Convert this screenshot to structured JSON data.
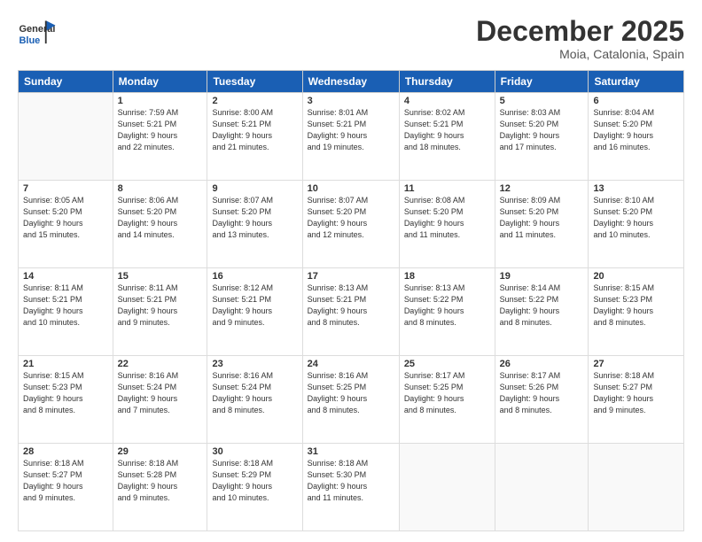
{
  "header": {
    "logo_line1": "General",
    "logo_line2": "Blue",
    "month": "December 2025",
    "location": "Moia, Catalonia, Spain"
  },
  "weekdays": [
    "Sunday",
    "Monday",
    "Tuesday",
    "Wednesday",
    "Thursday",
    "Friday",
    "Saturday"
  ],
  "weeks": [
    [
      {
        "day": "",
        "info": ""
      },
      {
        "day": "1",
        "info": "Sunrise: 7:59 AM\nSunset: 5:21 PM\nDaylight: 9 hours\nand 22 minutes."
      },
      {
        "day": "2",
        "info": "Sunrise: 8:00 AM\nSunset: 5:21 PM\nDaylight: 9 hours\nand 21 minutes."
      },
      {
        "day": "3",
        "info": "Sunrise: 8:01 AM\nSunset: 5:21 PM\nDaylight: 9 hours\nand 19 minutes."
      },
      {
        "day": "4",
        "info": "Sunrise: 8:02 AM\nSunset: 5:21 PM\nDaylight: 9 hours\nand 18 minutes."
      },
      {
        "day": "5",
        "info": "Sunrise: 8:03 AM\nSunset: 5:20 PM\nDaylight: 9 hours\nand 17 minutes."
      },
      {
        "day": "6",
        "info": "Sunrise: 8:04 AM\nSunset: 5:20 PM\nDaylight: 9 hours\nand 16 minutes."
      }
    ],
    [
      {
        "day": "7",
        "info": "Sunrise: 8:05 AM\nSunset: 5:20 PM\nDaylight: 9 hours\nand 15 minutes."
      },
      {
        "day": "8",
        "info": "Sunrise: 8:06 AM\nSunset: 5:20 PM\nDaylight: 9 hours\nand 14 minutes."
      },
      {
        "day": "9",
        "info": "Sunrise: 8:07 AM\nSunset: 5:20 PM\nDaylight: 9 hours\nand 13 minutes."
      },
      {
        "day": "10",
        "info": "Sunrise: 8:07 AM\nSunset: 5:20 PM\nDaylight: 9 hours\nand 12 minutes."
      },
      {
        "day": "11",
        "info": "Sunrise: 8:08 AM\nSunset: 5:20 PM\nDaylight: 9 hours\nand 11 minutes."
      },
      {
        "day": "12",
        "info": "Sunrise: 8:09 AM\nSunset: 5:20 PM\nDaylight: 9 hours\nand 11 minutes."
      },
      {
        "day": "13",
        "info": "Sunrise: 8:10 AM\nSunset: 5:20 PM\nDaylight: 9 hours\nand 10 minutes."
      }
    ],
    [
      {
        "day": "14",
        "info": "Sunrise: 8:11 AM\nSunset: 5:21 PM\nDaylight: 9 hours\nand 10 minutes."
      },
      {
        "day": "15",
        "info": "Sunrise: 8:11 AM\nSunset: 5:21 PM\nDaylight: 9 hours\nand 9 minutes."
      },
      {
        "day": "16",
        "info": "Sunrise: 8:12 AM\nSunset: 5:21 PM\nDaylight: 9 hours\nand 9 minutes."
      },
      {
        "day": "17",
        "info": "Sunrise: 8:13 AM\nSunset: 5:21 PM\nDaylight: 9 hours\nand 8 minutes."
      },
      {
        "day": "18",
        "info": "Sunrise: 8:13 AM\nSunset: 5:22 PM\nDaylight: 9 hours\nand 8 minutes."
      },
      {
        "day": "19",
        "info": "Sunrise: 8:14 AM\nSunset: 5:22 PM\nDaylight: 9 hours\nand 8 minutes."
      },
      {
        "day": "20",
        "info": "Sunrise: 8:15 AM\nSunset: 5:23 PM\nDaylight: 9 hours\nand 8 minutes."
      }
    ],
    [
      {
        "day": "21",
        "info": "Sunrise: 8:15 AM\nSunset: 5:23 PM\nDaylight: 9 hours\nand 8 minutes."
      },
      {
        "day": "22",
        "info": "Sunrise: 8:16 AM\nSunset: 5:24 PM\nDaylight: 9 hours\nand 7 minutes."
      },
      {
        "day": "23",
        "info": "Sunrise: 8:16 AM\nSunset: 5:24 PM\nDaylight: 9 hours\nand 8 minutes."
      },
      {
        "day": "24",
        "info": "Sunrise: 8:16 AM\nSunset: 5:25 PM\nDaylight: 9 hours\nand 8 minutes."
      },
      {
        "day": "25",
        "info": "Sunrise: 8:17 AM\nSunset: 5:25 PM\nDaylight: 9 hours\nand 8 minutes."
      },
      {
        "day": "26",
        "info": "Sunrise: 8:17 AM\nSunset: 5:26 PM\nDaylight: 9 hours\nand 8 minutes."
      },
      {
        "day": "27",
        "info": "Sunrise: 8:18 AM\nSunset: 5:27 PM\nDaylight: 9 hours\nand 9 minutes."
      }
    ],
    [
      {
        "day": "28",
        "info": "Sunrise: 8:18 AM\nSunset: 5:27 PM\nDaylight: 9 hours\nand 9 minutes."
      },
      {
        "day": "29",
        "info": "Sunrise: 8:18 AM\nSunset: 5:28 PM\nDaylight: 9 hours\nand 9 minutes."
      },
      {
        "day": "30",
        "info": "Sunrise: 8:18 AM\nSunset: 5:29 PM\nDaylight: 9 hours\nand 10 minutes."
      },
      {
        "day": "31",
        "info": "Sunrise: 8:18 AM\nSunset: 5:30 PM\nDaylight: 9 hours\nand 11 minutes."
      },
      {
        "day": "",
        "info": ""
      },
      {
        "day": "",
        "info": ""
      },
      {
        "day": "",
        "info": ""
      }
    ]
  ]
}
